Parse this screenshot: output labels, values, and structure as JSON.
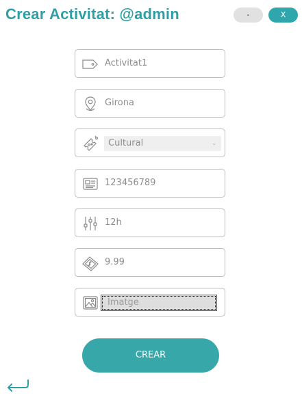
{
  "header": {
    "title": "Crear Activitat: @admin",
    "minimize_label": "-",
    "close_label": "X"
  },
  "form": {
    "name_value": "Activitat1",
    "location_value": "Girona",
    "category_selected": "Cultural",
    "phone_value": "123456789",
    "duration_value": "12h",
    "price_value": "9.99",
    "image_label": "Imatge",
    "submit_label": "CREAR"
  },
  "icons": {
    "name": "tag-icon",
    "location": "map-pin-icon",
    "category": "ticket-icon",
    "phone": "id-card-icon",
    "duration": "sliders-icon",
    "price": "money-bill-icon",
    "image": "image-icon",
    "back": "back-arrow-icon"
  },
  "colors": {
    "accent": "#2f9fa5",
    "button": "#37a7a9",
    "minimize_button": "#e1e1e1"
  }
}
